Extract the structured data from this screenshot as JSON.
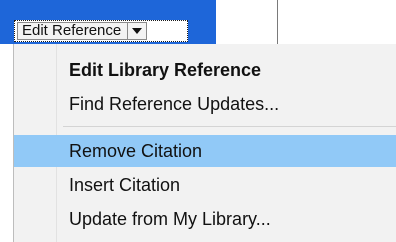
{
  "field_button": {
    "label": "Edit Reference",
    "arrow_icon": "chevron-down-icon"
  },
  "menu": {
    "items": [
      {
        "label": "Edit Library Reference",
        "bold": true,
        "hover": false
      },
      {
        "label": "Find Reference Updates...",
        "bold": false,
        "hover": false
      },
      {
        "label": "Remove Citation",
        "bold": false,
        "hover": true
      },
      {
        "label": "Insert Citation",
        "bold": false,
        "hover": false
      },
      {
        "label": "Update from My Library...",
        "bold": false,
        "hover": false
      }
    ]
  },
  "colors": {
    "accent_bar": "#1e66d9",
    "hover": "#91c9f7",
    "menu_bg": "#f2f2f2"
  }
}
